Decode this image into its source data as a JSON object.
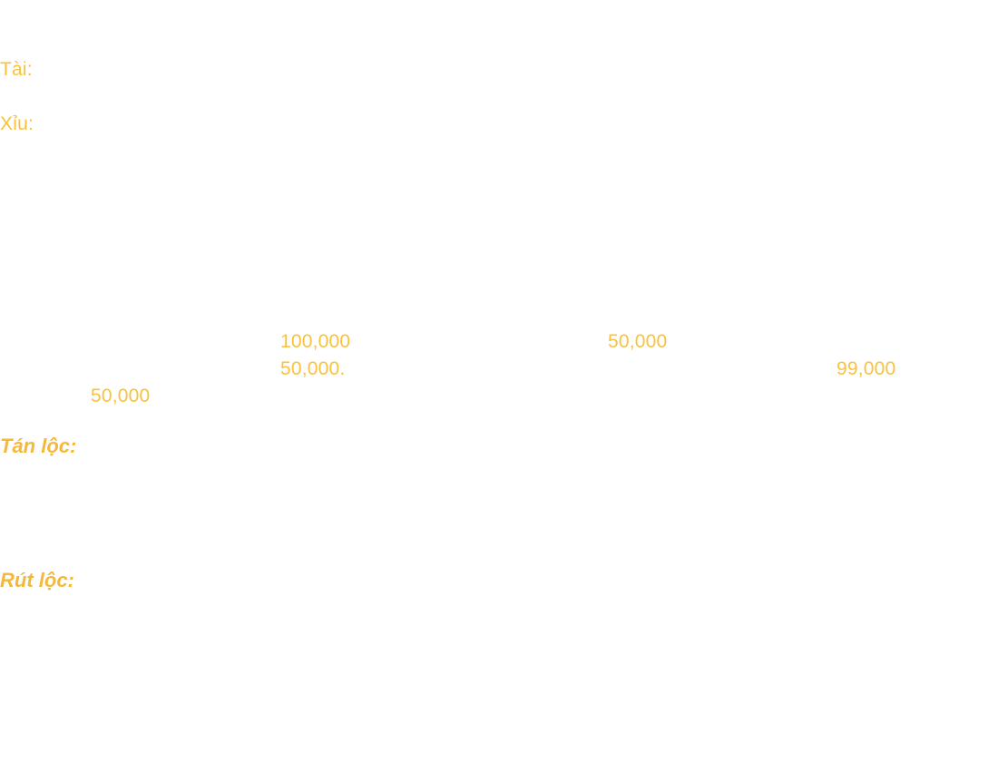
{
  "labels": {
    "tai": "Tài:",
    "xiu": "Xỉu:"
  },
  "amounts": {
    "row1_a": "100,000",
    "row1_b": "50,000",
    "row2_a": "50,000.",
    "row2_b": "99,000",
    "row3_a": "50,000"
  },
  "sections": {
    "tan_loc": "Tán lộc:",
    "rut_loc": "Rút lộc:"
  },
  "colors": {
    "text": "#f8c23a",
    "heading": "#f4b93a",
    "background": "#ffffff"
  }
}
